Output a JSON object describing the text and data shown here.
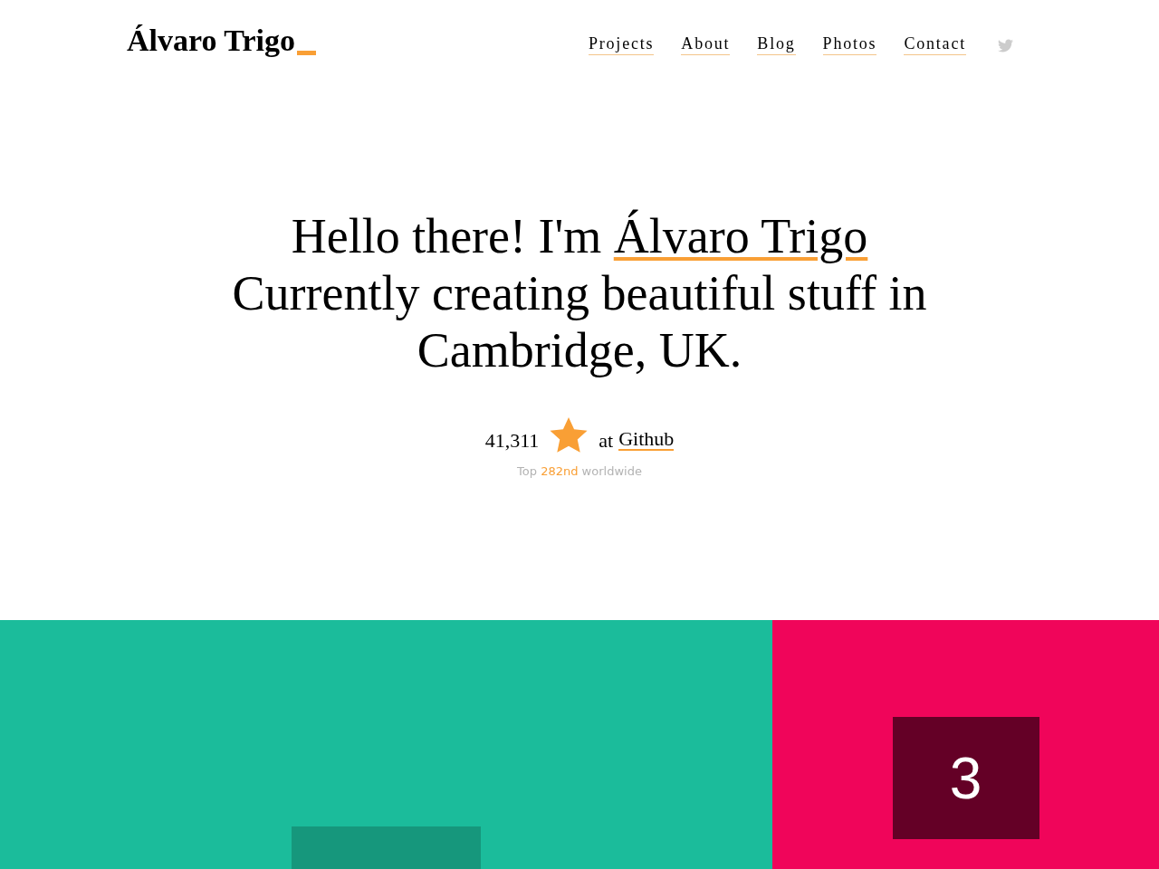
{
  "header": {
    "logo": "Álvaro Trigo",
    "nav": [
      "Projects",
      "About",
      "Blog",
      "Photos",
      "Contact"
    ]
  },
  "hero": {
    "greeting": "Hello there! I'm",
    "name_link": "Álvaro Trigo",
    "tagline": "Currently creating beautiful stuff in Cambridge, UK."
  },
  "github": {
    "count": "41,311",
    "prefix": "at",
    "link": "Github",
    "ranking": {
      "prefix": "Top",
      "rank": "282nd",
      "suffix": "worldwide"
    }
  },
  "demo": {
    "tile_label": "3"
  }
}
